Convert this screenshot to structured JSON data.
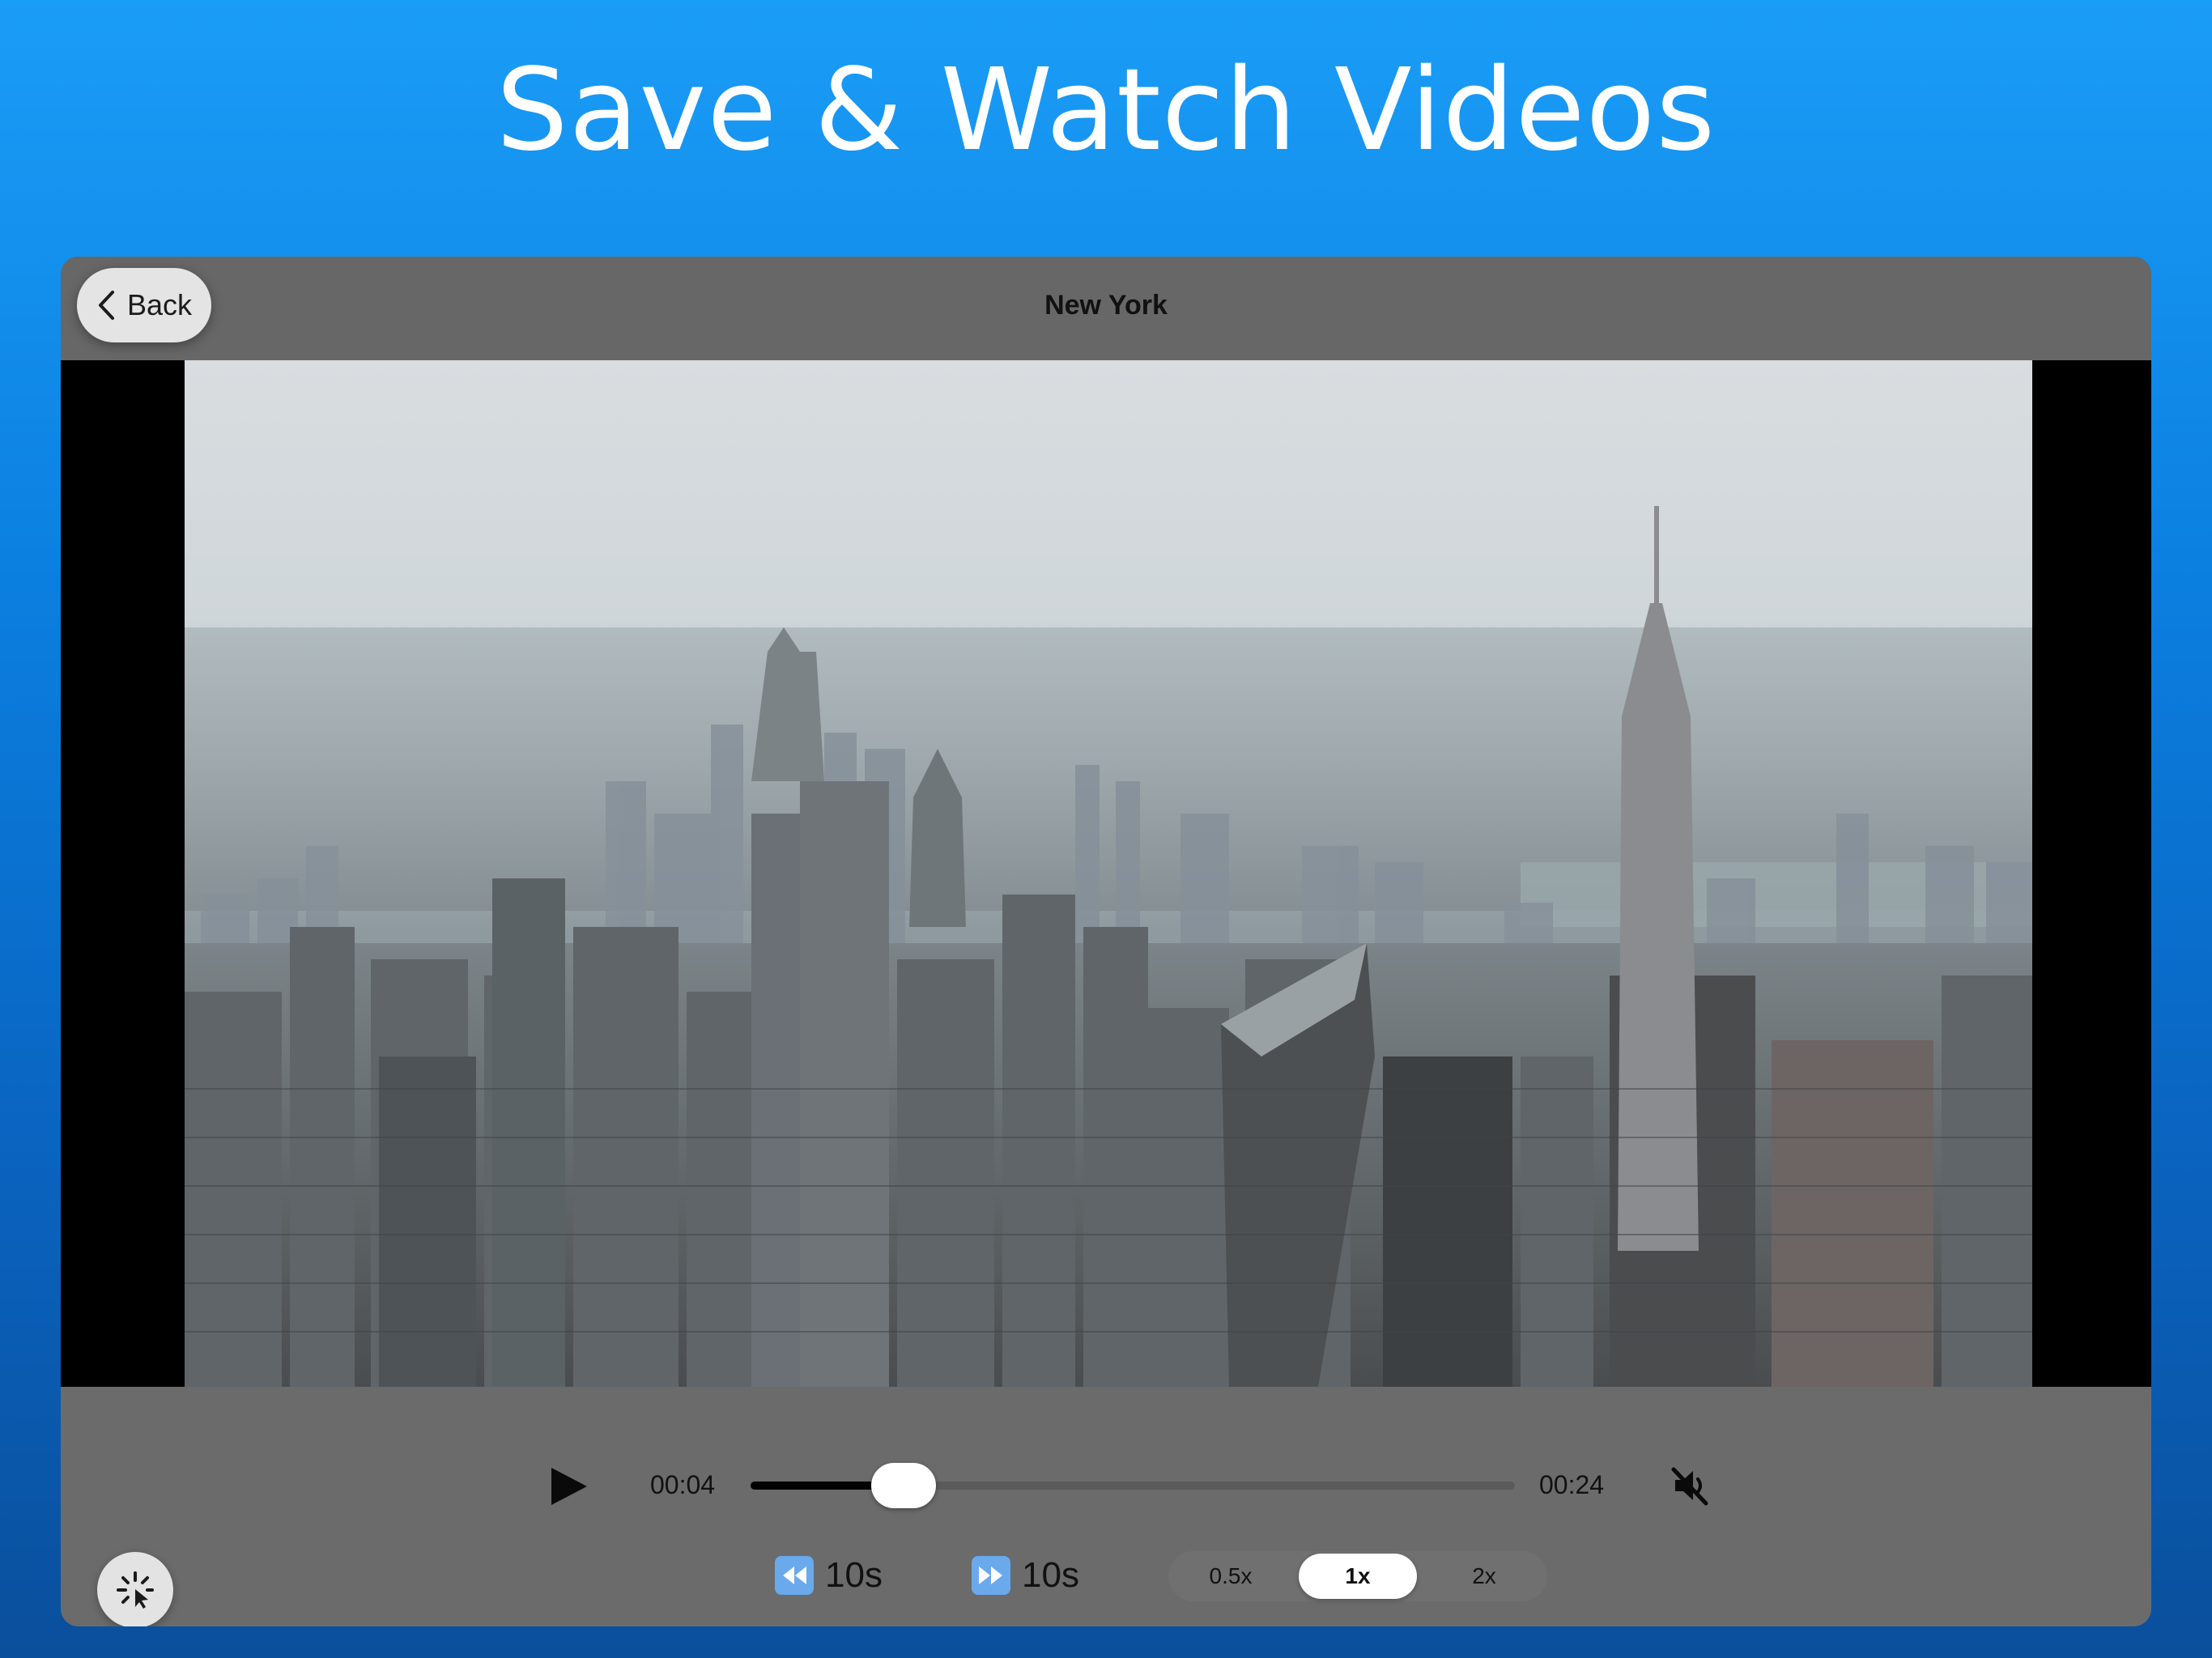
{
  "headline": "Save & Watch Videos",
  "nav": {
    "back_label": "Back",
    "title": "New York"
  },
  "video": {
    "description_icon": "city-skyline-video-frame"
  },
  "playback": {
    "current_time": "00:04",
    "total_time": "00:24",
    "progress_fraction": 0.2,
    "play_icon": "play-icon",
    "mute_icon": "speaker-muted-icon",
    "muted": true
  },
  "skip": {
    "back_label": "10s",
    "forward_label": "10s",
    "back_icon": "rewind-icon",
    "forward_icon": "fast-forward-icon"
  },
  "speed": {
    "options": [
      "0.5x",
      "1x",
      "2x"
    ],
    "selected": "1x"
  },
  "loader_icon": "spinner-cursor-icon",
  "colors": {
    "background_top": "#1a9df7",
    "background_bottom": "#0a4f9c",
    "panel": "#666666",
    "skip_icon": "#6aa9ec"
  }
}
